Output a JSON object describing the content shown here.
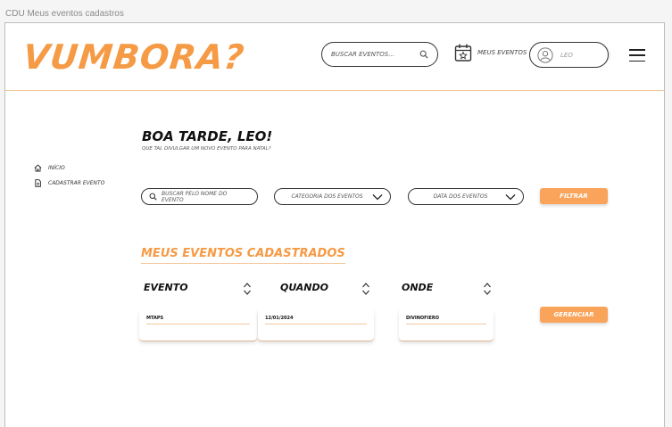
{
  "caption": "CDU Meus eventos cadastros",
  "header": {
    "logo": "VUMBORA?",
    "search_placeholder": "BUSCAR EVENTOS...",
    "events_label": "MEUS EVENTOS",
    "user_name": "LEO"
  },
  "sidebar": {
    "items": [
      {
        "label": "INÍCIO",
        "icon": "home-icon"
      },
      {
        "label": "CADASTRAR EVENTO",
        "icon": "document-icon"
      }
    ]
  },
  "main": {
    "greeting": "BOA TARDE, LEO!",
    "subtitle": "QUE TAL DIVULGAR UM NOVO EVENTO PARA NATAL?",
    "filters": {
      "name_search_placeholder": "BUSCAR PELO NOME DO EVENTO",
      "category_label": "CATEGORIA DOS EVENTOS",
      "date_label": "DATA DOS EVENTOS",
      "filter_button": "FILTRAR"
    },
    "section_title": "MEUS EVENTOS CADASTRADOS",
    "columns": [
      "EVENTO",
      "QUANDO",
      "ONDE"
    ],
    "rows": [
      {
        "evento": "MTAPS",
        "quando": "12/01/2024",
        "onde": "DIVINOFIERO"
      }
    ],
    "manage_button": "GERENCIAR"
  },
  "colors": {
    "accent": "#f59a45",
    "button": "#f9a45a",
    "divider": "#f3c79d"
  }
}
